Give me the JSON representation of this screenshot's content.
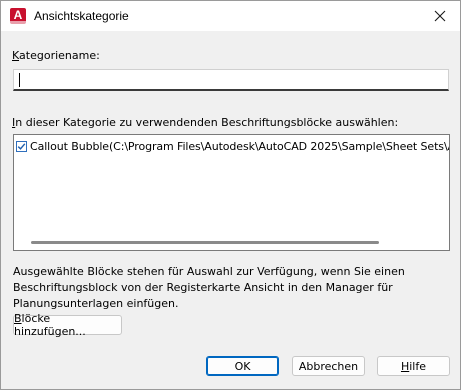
{
  "window": {
    "title": "Ansichtskategorie",
    "app_icon_letter": "A",
    "close_icon": "close-icon"
  },
  "name_section": {
    "label": "Kategoriename:",
    "value": ""
  },
  "blocks_section": {
    "label": "In dieser Kategorie zu verwendenden Beschriftungsblöcke auswählen:",
    "items": [
      {
        "checked": true,
        "text": "Callout Bubble(C:\\Program Files\\Autodesk\\AutoCAD 2025\\Sample\\Sheet Sets\\Architectu"
      }
    ]
  },
  "info_text": "Ausgewählte Blöcke stehen für Auswahl zur Verfügung, wenn Sie einen Beschriftungsblock von der Registerkarte Ansicht in den Manager für Planungsunterlagen einfügen.",
  "buttons": {
    "add_blocks": "Blöcke hinzufügen...",
    "ok": "OK",
    "cancel": "Abbrechen",
    "help": "Hilfe"
  },
  "colors": {
    "app_icon": "#c8102e",
    "accent": "#0067c0",
    "dialog_bg": "#f0f0f0"
  }
}
